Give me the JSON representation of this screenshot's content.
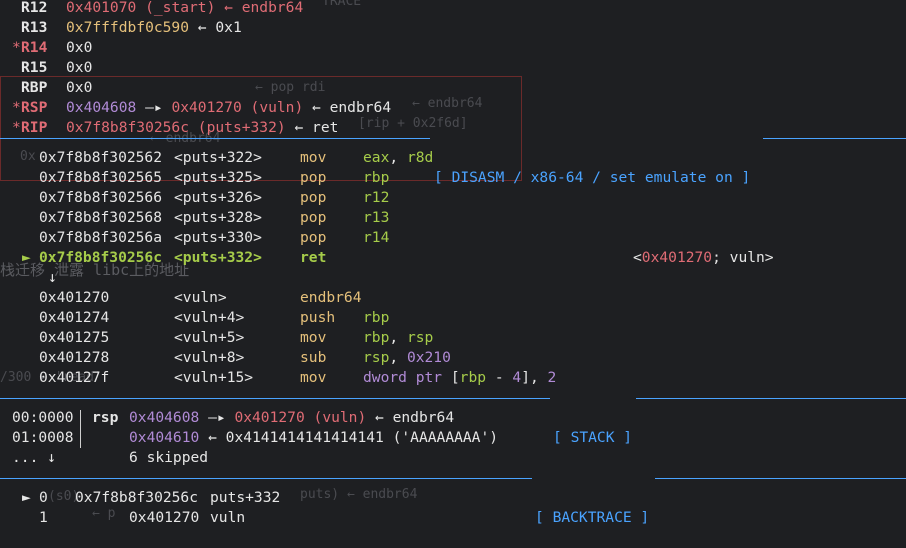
{
  "ghost": {
    "top_label": "TRACE",
    "pop_rdi": "← pop rdi",
    "endbr_r": "← endbr64",
    "rip_expr": "[rip + 0x2f6d]",
    "endbr_l": "← endbr64",
    "zero_x": "0x",
    "leak_text": "栈迁移 泄露 libc上的地址",
    "read_text": "/300 ▸ 'read'",
    "puts_text": "puts) ← endbr64",
    "frag_1": "(s0)",
    "frag_2": "← p"
  },
  "registers": [
    {
      "name": "R12",
      "changed": false,
      "value": "0x401070",
      "value_color": "red",
      "extra": " (_start) ← endbr64",
      "extra_color": "red"
    },
    {
      "name": "R13",
      "changed": false,
      "value": "0x7fffdbf0c590",
      "value_color": "yel",
      "extra": " ← 0x1",
      "extra_color": "w"
    },
    {
      "name": "R14",
      "changed": true,
      "value": "0x0",
      "value_color": "w",
      "extra": "",
      "extra_color": "w"
    },
    {
      "name": "R15",
      "changed": false,
      "value": "0x0",
      "value_color": "w",
      "extra": "",
      "extra_color": "w"
    },
    {
      "name": "RBP",
      "changed": false,
      "value": "0x0",
      "value_color": "w",
      "extra": "",
      "extra_color": "w"
    },
    {
      "name": "RSP",
      "changed": true,
      "value": "0x404608",
      "value_color": "pur",
      "extra": "",
      "extra_color": "w"
    },
    {
      "name": "RIP",
      "changed": true,
      "value": "0x7f8b8f30256c",
      "value_color": "red",
      "extra": "",
      "extra_color": "w"
    }
  ],
  "rsp_chain": {
    "arrow": " —▸ ",
    "target": "0x401270 (vuln)",
    "tail": " ← endbr64"
  },
  "rip_chain": {
    "sym": " (puts+332)",
    "tail": " ← ret"
  },
  "disasm": {
    "header": "[ DISASM / x86-64 / set emulate on ]",
    "rows": [
      {
        "marker": "",
        "addr": "0x7f8b8f302562",
        "sym": "<puts+322>",
        "mn": "mov",
        "ops": [
          [
            "eax",
            "grn"
          ],
          [
            ", ",
            "w"
          ],
          [
            "r8d",
            "grn"
          ]
        ],
        "current": false
      },
      {
        "marker": "",
        "addr": "0x7f8b8f302565",
        "sym": "<puts+325>",
        "mn": "pop",
        "ops": [
          [
            "rbp",
            "grn"
          ]
        ],
        "current": false
      },
      {
        "marker": "",
        "addr": "0x7f8b8f302566",
        "sym": "<puts+326>",
        "mn": "pop",
        "ops": [
          [
            "r12",
            "grn"
          ]
        ],
        "current": false
      },
      {
        "marker": "",
        "addr": "0x7f8b8f302568",
        "sym": "<puts+328>",
        "mn": "pop",
        "ops": [
          [
            "r13",
            "grn"
          ]
        ],
        "current": false
      },
      {
        "marker": "",
        "addr": "0x7f8b8f30256a",
        "sym": "<puts+330>",
        "mn": "pop",
        "ops": [
          [
            "r14",
            "grn"
          ]
        ],
        "current": false
      },
      {
        "marker": "►",
        "addr": "0x7f8b8f30256c",
        "sym": "<puts+332>",
        "mn": "ret",
        "ops": [],
        "current": true
      }
    ],
    "ret_target": {
      "open": "<",
      "addr": "0x401270",
      "rest": "; vuln>"
    },
    "down_arrow": "↓",
    "rows2": [
      {
        "addr": "0x401270",
        "sym": "<vuln>",
        "mn": "endbr64",
        "ops": []
      },
      {
        "addr": "0x401274",
        "sym": "<vuln+4>",
        "mn": "push",
        "ops": [
          [
            "rbp",
            "grn"
          ]
        ]
      },
      {
        "addr": "0x401275",
        "sym": "<vuln+5>",
        "mn": "mov",
        "ops": [
          [
            "rbp",
            "grn"
          ],
          [
            ", ",
            "w"
          ],
          [
            "rsp",
            "grn"
          ]
        ]
      },
      {
        "addr": "0x401278",
        "sym": "<vuln+8>",
        "mn": "sub",
        "ops": [
          [
            "rsp",
            "grn"
          ],
          [
            ", ",
            "w"
          ],
          [
            "0x210",
            "pur"
          ]
        ]
      },
      {
        "addr": "0x40127f",
        "sym": "<vuln+15>",
        "mn": "mov",
        "ops": [
          [
            "dword ptr ",
            "pur"
          ],
          [
            "[",
            "w"
          ],
          [
            "rbp",
            "grn"
          ],
          [
            " - ",
            "w"
          ],
          [
            "4",
            "pur"
          ],
          [
            "], ",
            "w"
          ],
          [
            "2",
            "pur"
          ]
        ]
      }
    ]
  },
  "stack": {
    "header": "[ STACK ]",
    "rows": [
      {
        "idx": "00:0000",
        "reg": "rsp",
        "addr": "0x404608",
        "arrow": " —▸ ",
        "target": "0x401270 (vuln)",
        "tail": " ← endbr64"
      },
      {
        "idx": "01:0008",
        "reg": "",
        "addr": "0x404610",
        "arrow": " ← ",
        "target": "0x4141414141414141",
        "tail": " ('AAAAAAAA')"
      }
    ],
    "skip": {
      "dots": "... ↓",
      "text": "6 skipped"
    }
  },
  "backtrace": {
    "header": "[ BACKTRACE ]",
    "frames": [
      {
        "marker": "►",
        "num": "0",
        "addr": "0x7f8b8f30256c",
        "name": "puts+332"
      },
      {
        "marker": "",
        "num": "1",
        "addr": "0x401270",
        "name": "vuln"
      }
    ]
  }
}
